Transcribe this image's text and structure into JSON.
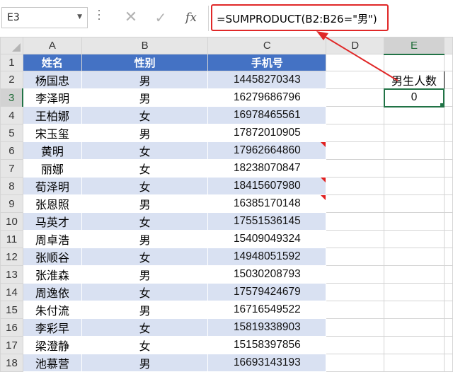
{
  "formula_bar": {
    "name_box": "E3",
    "formula": "=SUMPRODUCT(B2:B26=\"男\")",
    "cancel_icon": "close-icon",
    "enter_icon": "check-icon",
    "function_label": "fx"
  },
  "columns": [
    "A",
    "B",
    "C",
    "D",
    "E"
  ],
  "rows": [
    "1",
    "2",
    "3",
    "4",
    "5",
    "6",
    "7",
    "8",
    "9",
    "10",
    "11",
    "12",
    "13",
    "14",
    "15",
    "16",
    "17",
    "18"
  ],
  "headers": {
    "name": "姓名",
    "gender": "性别",
    "phone": "手机号"
  },
  "records": [
    {
      "name": "杨国忠",
      "gender": "男",
      "phone": "14458270343",
      "comment": false
    },
    {
      "name": "李泽明",
      "gender": "男",
      "phone": "16279686796",
      "comment": false
    },
    {
      "name": "王柏娜",
      "gender": "女",
      "phone": "16978465561",
      "comment": false
    },
    {
      "name": "宋玉玺",
      "gender": "男",
      "phone": "17872010905",
      "comment": false
    },
    {
      "name": "黄明",
      "gender": "女",
      "phone": "17962664860",
      "comment": true
    },
    {
      "name": "丽娜",
      "gender": "女",
      "phone": "18238070847",
      "comment": false
    },
    {
      "name": "荀泽明",
      "gender": "女",
      "phone": "18415607980",
      "comment": true
    },
    {
      "name": "张恩照",
      "gender": "男",
      "phone": "16385170148",
      "comment": true
    },
    {
      "name": "马英才",
      "gender": "女",
      "phone": "17551536145",
      "comment": false
    },
    {
      "name": "周卓浩",
      "gender": "男",
      "phone": "15409049324",
      "comment": false
    },
    {
      "name": "张顺谷",
      "gender": "女",
      "phone": "14948051592",
      "comment": false
    },
    {
      "name": "张淮森",
      "gender": "男",
      "phone": "15030208793",
      "comment": false
    },
    {
      "name": "周逸依",
      "gender": "女",
      "phone": "17579424679",
      "comment": false
    },
    {
      "name": "朱付流",
      "gender": "男",
      "phone": "16716549522",
      "comment": false
    },
    {
      "name": "李彩早",
      "gender": "女",
      "phone": "15819338903",
      "comment": false
    },
    {
      "name": "梁澄静",
      "gender": "女",
      "phone": "15158397856",
      "comment": false
    },
    {
      "name": "池慕营",
      "gender": "男",
      "phone": "16693143193",
      "comment": false
    }
  ],
  "summary": {
    "label": "男生人数",
    "value": "0"
  },
  "colors": {
    "header_fill": "#4472c4",
    "band_fill": "#d9e1f2",
    "annotation": "#e02828",
    "selection": "#217346"
  }
}
